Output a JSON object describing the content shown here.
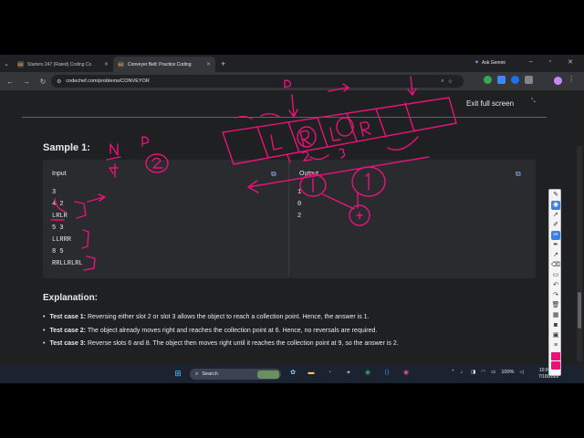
{
  "browser": {
    "tabs": [
      {
        "favicon": "CC",
        "title": "Starters 247 (Rated) Coding Co"
      },
      {
        "favicon": "CC",
        "title": "Conveyer Belt: Practice Coding"
      }
    ],
    "ask_gemini": "Ask Gemini",
    "url": "codechef.com/problems/CONVEYOR"
  },
  "page": {
    "exit_fullscreen": "Exit full screen",
    "sample_title": "Sample 1:",
    "input_header": "Input",
    "output_header": "Output",
    "input_lines": [
      "3",
      "4 2",
      "LRLR",
      "5 3",
      "LLRRR",
      "8 5",
      "RRLLRLRL"
    ],
    "output_lines": [
      "1",
      "0",
      "2"
    ],
    "explanation_title": "Explanation:",
    "explanations": [
      {
        "label": "Test case 1:",
        "text": " Reversing either slot 2 or slot 3 allows the object to reach a collection point. Hence, the answer is 1."
      },
      {
        "label": "Test case 2:",
        "text": " The object already moves right and reaches the collection point at 6. Hence, no reversals are required."
      },
      {
        "label": "Test case 3:",
        "text": " Reverse slots 6 and 8. The object then moves right until it reaches the collection point at 9, so the answer is 2."
      }
    ]
  },
  "taskbar": {
    "search": "Search",
    "battery": "100%",
    "time": "10:00 PM",
    "date": "7/18/2026"
  },
  "colors": {
    "ink": "#e8137a",
    "link": "#8ab4f8",
    "page_bg": "#1f2022"
  }
}
